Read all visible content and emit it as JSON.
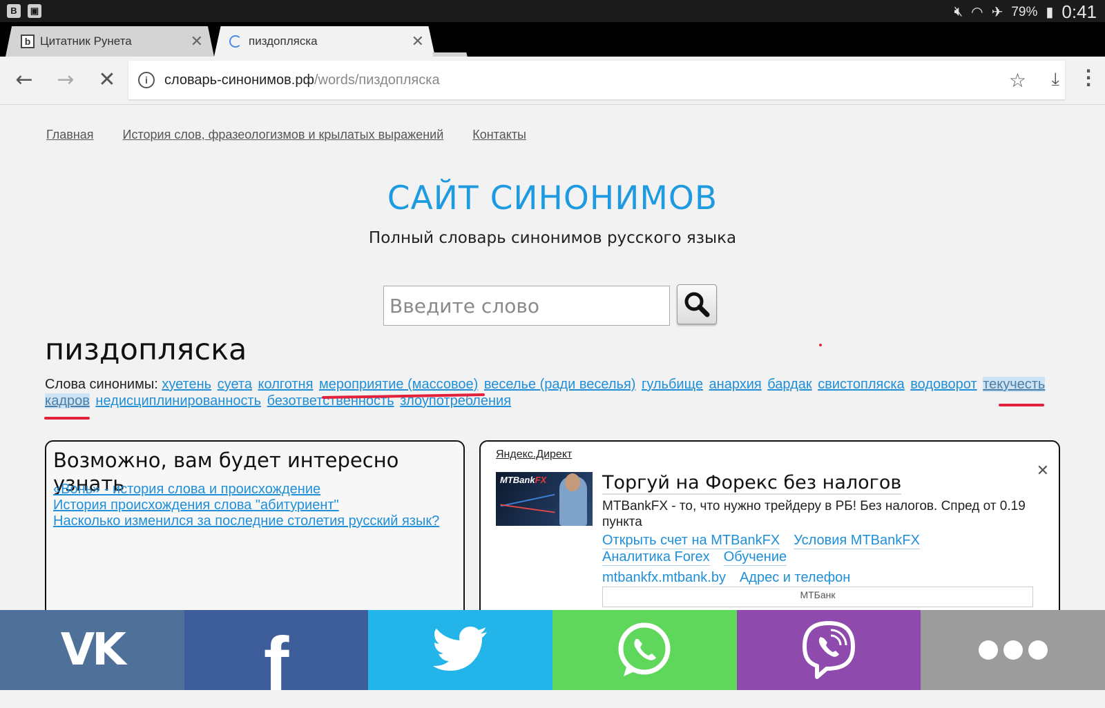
{
  "status_bar": {
    "battery": "79%",
    "time": "0:41",
    "left_icons": [
      "vk-notification-icon",
      "briefcase-icon"
    ],
    "right_icons": [
      "mute-icon",
      "wifi-icon",
      "airplane-icon",
      "battery-icon"
    ]
  },
  "tabs": [
    {
      "title": "Цитатник Рунета",
      "favicon": "b",
      "active": false
    },
    {
      "title": "пиздопляска",
      "active": true,
      "loading": true
    }
  ],
  "omnibox": {
    "domain": "словарь-синонимов.рф",
    "path": "/words/пиздопляска"
  },
  "nav": {
    "home": "Главная",
    "history": "История слов, фразеологизмов и крылатых выражений",
    "contacts": "Контакты"
  },
  "site": {
    "title": "САЙТ СИНОНИМОВ",
    "subtitle": "Полный словарь синонимов русского языка",
    "search_placeholder": "Введите слово"
  },
  "word": "пиздопляска",
  "synonyms": {
    "label": "Слова синонимы:",
    "items": [
      "хуетень",
      "суета",
      "колготня",
      "мероприятие (массовое)",
      "веселье (ради веселья)",
      "гульбище",
      "анархия",
      "бардак",
      "свистопляска",
      "водоворот",
      "текучесть",
      "кадров",
      "недисциплинированность",
      "безответственность",
      "злоупотребления"
    ]
  },
  "interesting": {
    "title": "Возможно, вам будет интересно узнать",
    "links": [
      "«Вонь» - история слова и происхождение",
      "История происхождения слова \"абитуриент\"",
      "Насколько изменился за последние столетия русский язык?"
    ]
  },
  "ad": {
    "label": "Яндекс.Директ",
    "image_brand_a": "MTBank",
    "image_brand_b": "FX",
    "headline": "Торгуй на Форекс без налогов",
    "description": "MTBankFX - то, что нужно трейдеру в РБ! Без налогов. Спред от 0.19 пункта",
    "links": [
      "Открыть счет на MTBankFX",
      "Условия MTBankFX",
      "Аналитика Forex",
      "Обучение"
    ],
    "domain": "mtbankfx.mtbank.by",
    "contact": "Адрес и телефон",
    "footer": "МТБанк"
  },
  "share": [
    "vk",
    "facebook",
    "twitter",
    "whatsapp",
    "viber",
    "more"
  ],
  "colors": {
    "link": "#1e8fd8",
    "title": "#1e9be0",
    "vk": "#4e7099",
    "facebook": "#3e5d9b",
    "twitter": "#23b4ea",
    "whatsapp": "#5fd75b",
    "viber": "#8e4bad",
    "more": "#9c9c9c",
    "annotation": "#e2223b"
  }
}
